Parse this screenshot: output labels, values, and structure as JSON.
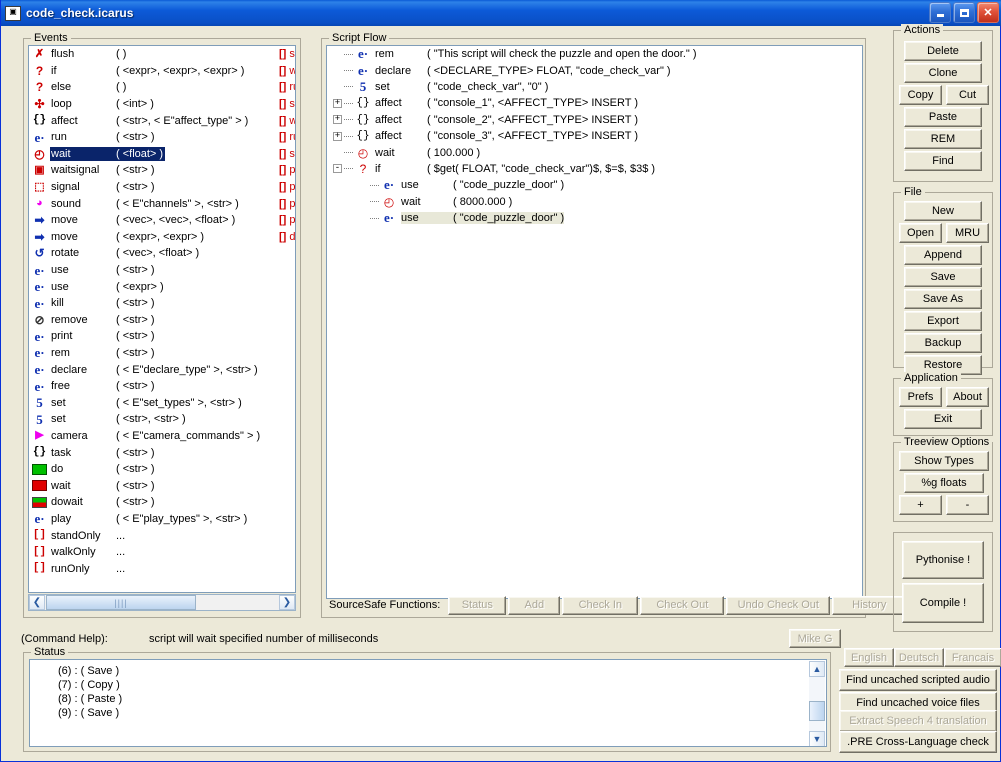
{
  "window": {
    "title": "code_check.icarus",
    "icon": "app-icon",
    "minimize": "_",
    "maximize": "□",
    "close": "✕"
  },
  "events_panel": {
    "label": "Events",
    "selected_index": 6,
    "items": [
      {
        "icon": "flush-icon",
        "glyph": "✗",
        "cls": "ic-flush",
        "name": "flush",
        "args": "(   )",
        "tail": "st"
      },
      {
        "icon": "question-icon",
        "glyph": "?",
        "cls": "ic-q",
        "name": "if",
        "args": "( <expr>, <expr>, <expr>  )",
        "tail": "w"
      },
      {
        "icon": "question-icon",
        "glyph": "?",
        "cls": "ic-q",
        "name": "else",
        "args": "(   )",
        "tail": "ru"
      },
      {
        "icon": "loop-icon",
        "glyph": "✣",
        "cls": "ic-loop",
        "name": "loop",
        "args": "( <int>  )",
        "tail": "st"
      },
      {
        "icon": "braces-icon",
        "glyph": "{}",
        "cls": "ic-brace",
        "name": "affect",
        "args": "( <str>, < E\"affect_type\" >  )",
        "tail": "w"
      },
      {
        "icon": "e-icon",
        "glyph": "e·",
        "cls": "ic-e",
        "name": "run",
        "args": "( <str>  )",
        "tail": "ru"
      },
      {
        "icon": "clock-icon",
        "glyph": "◴",
        "cls": "ic-clock",
        "name": "wait",
        "args": "( <float>  )",
        "tail": "st"
      },
      {
        "icon": "waitsignal-icon",
        "glyph": "▣",
        "cls": "ic-sq",
        "name": "waitsignal",
        "args": "( <str>  )",
        "tail": "pa"
      },
      {
        "icon": "signal-icon",
        "glyph": "⬚",
        "cls": "ic-sq",
        "name": "signal",
        "args": "( <str>  )",
        "tail": "pa"
      },
      {
        "icon": "sound-icon",
        "glyph": "◕",
        "cls": "ic-sound",
        "name": "sound",
        "args": "( < E\"channels\" >, <str>  )",
        "tail": "pa"
      },
      {
        "icon": "arrow-right-icon",
        "glyph": "➡",
        "cls": "ic-move",
        "name": "move",
        "args": "( <vec>, <vec>, <float>  )",
        "tail": "pa"
      },
      {
        "icon": "arrow-right-icon",
        "glyph": "➡",
        "cls": "ic-move",
        "name": "move",
        "args": "( <expr>, <expr>  )",
        "tail": "de"
      },
      {
        "icon": "rotate-icon",
        "glyph": "↺",
        "cls": "ic-rot",
        "name": "rotate",
        "args": "( <vec>, <float>  )",
        "tail": ""
      },
      {
        "icon": "e-icon",
        "glyph": "e·",
        "cls": "ic-e",
        "name": "use",
        "args": "( <str>  )",
        "tail": ""
      },
      {
        "icon": "e-icon",
        "glyph": "e·",
        "cls": "ic-e",
        "name": "use",
        "args": "( <expr>  )",
        "tail": ""
      },
      {
        "icon": "e-icon",
        "glyph": "e·",
        "cls": "ic-e",
        "name": "kill",
        "args": "( <str>  )",
        "tail": ""
      },
      {
        "icon": "remove-icon",
        "glyph": "⊘",
        "cls": "ic-rem",
        "name": "remove",
        "args": "( <str>  )",
        "tail": ""
      },
      {
        "icon": "e-icon",
        "glyph": "e·",
        "cls": "ic-e",
        "name": "print",
        "args": "( <str>  )",
        "tail": ""
      },
      {
        "icon": "e-icon",
        "glyph": "e·",
        "cls": "ic-e",
        "name": "rem",
        "args": "( <str>  )",
        "tail": ""
      },
      {
        "icon": "e-icon",
        "glyph": "e·",
        "cls": "ic-e",
        "name": "declare",
        "args": "( < E\"declare_type\" >, <str>  )",
        "tail": ""
      },
      {
        "icon": "e-icon",
        "glyph": "e·",
        "cls": "ic-e",
        "name": "free",
        "args": "( <str>  )",
        "tail": ""
      },
      {
        "icon": "set-icon",
        "glyph": "5",
        "cls": "ic-s5",
        "name": "set",
        "args": "( < E\"set_types\" >, <str>  )",
        "tail": ""
      },
      {
        "icon": "set-icon",
        "glyph": "5",
        "cls": "ic-s5",
        "name": "set",
        "args": "( <str>, <str>  )",
        "tail": ""
      },
      {
        "icon": "camera-icon",
        "glyph": "▶",
        "cls": "ic-cam",
        "name": "camera",
        "args": "( < E\"camera_commands\" >  )",
        "tail": ""
      },
      {
        "icon": "braces-icon",
        "glyph": "{}",
        "cls": "ic-brace",
        "name": "task",
        "args": "( <str>  )",
        "tail": ""
      },
      {
        "icon": "green-square-icon",
        "glyph": "",
        "cls": "ic-green",
        "name": "do",
        "args": "( <str>  )",
        "tail": ""
      },
      {
        "icon": "red-square-icon",
        "glyph": "",
        "cls": "ic-red",
        "name": "wait",
        "args": "( <str>  )",
        "tail": ""
      },
      {
        "icon": "split-square-icon",
        "glyph": "",
        "cls": "ic-split",
        "name": "dowait",
        "args": "( <str>  )",
        "tail": ""
      },
      {
        "icon": "e-icon",
        "glyph": "e·",
        "cls": "ic-e",
        "name": "play",
        "args": "( < E\"play_types\" >, <str>  )",
        "tail": ""
      },
      {
        "icon": "brackets-icon",
        "glyph": "[]",
        "cls": "ic-br",
        "name": "standOnly",
        "args": "...",
        "tail": ""
      },
      {
        "icon": "brackets-icon",
        "glyph": "[]",
        "cls": "ic-br",
        "name": "walkOnly",
        "args": "...",
        "tail": ""
      },
      {
        "icon": "brackets-icon",
        "glyph": "[]",
        "cls": "ic-br",
        "name": "runOnly",
        "args": "...",
        "tail": ""
      }
    ],
    "scroll_left_arrow": "❮",
    "scroll_right_arrow": "❯",
    "scroll_grip": "||||"
  },
  "script_flow_panel": {
    "label": "Script Flow",
    "rows": [
      {
        "depth": 0,
        "expander": "",
        "icon": "e-icon",
        "glyph": "e·",
        "cls": "ic-e",
        "name": "rem",
        "args": "( \"This script will check the puzzle and open the door.\"  )",
        "selected": false
      },
      {
        "depth": 0,
        "expander": "",
        "icon": "e-icon",
        "glyph": "e·",
        "cls": "ic-e",
        "name": "declare",
        "args": "( <DECLARE_TYPE> FLOAT, \"code_check_var\"  )",
        "selected": false
      },
      {
        "depth": 0,
        "expander": "",
        "icon": "set-icon",
        "glyph": "5",
        "cls": "ic-s5",
        "name": "set",
        "args": "( \"code_check_var\", \"0\"  )",
        "selected": false
      },
      {
        "depth": 0,
        "expander": "+",
        "icon": "braces-icon",
        "glyph": "{}",
        "cls": "ic-brace",
        "name": "affect",
        "args": "( \"console_1\", <AFFECT_TYPE> INSERT  )",
        "selected": false
      },
      {
        "depth": 0,
        "expander": "+",
        "icon": "braces-icon",
        "glyph": "{}",
        "cls": "ic-brace",
        "name": "affect",
        "args": "( \"console_2\", <AFFECT_TYPE> INSERT  )",
        "selected": false
      },
      {
        "depth": 0,
        "expander": "+",
        "icon": "braces-icon",
        "glyph": "{}",
        "cls": "ic-brace",
        "name": "affect",
        "args": "( \"console_3\", <AFFECT_TYPE> INSERT  )",
        "selected": false
      },
      {
        "depth": 0,
        "expander": "",
        "icon": "clock-icon",
        "glyph": "◴",
        "cls": "ic-clock",
        "name": "wait",
        "args": "( 100.000  )",
        "selected": false
      },
      {
        "depth": 0,
        "expander": "-",
        "icon": "question-icon",
        "glyph": "?",
        "cls": "ic-q",
        "name": "if",
        "args": "( $get( FLOAT, \"code_check_var\")$, $=$, $3$  )",
        "selected": false
      },
      {
        "depth": 1,
        "expander": "",
        "icon": "e-icon",
        "glyph": "e·",
        "cls": "ic-e",
        "name": "use",
        "args": "( \"code_puzzle_door\"  )",
        "selected": false
      },
      {
        "depth": 1,
        "expander": "",
        "icon": "clock-icon",
        "glyph": "◴",
        "cls": "ic-clock",
        "name": "wait",
        "args": "( 8000.000  )",
        "selected": false
      },
      {
        "depth": 1,
        "expander": "",
        "icon": "e-icon",
        "glyph": "e·",
        "cls": "ic-e",
        "name": "use",
        "args": "( \"code_puzzle_door\"  )",
        "selected": true
      }
    ]
  },
  "actions_panel": {
    "label": "Actions",
    "buttons": [
      {
        "name": "delete-button",
        "label": "Delete",
        "accel": "D",
        "enabled": true
      },
      {
        "name": "clone-button",
        "label": "Clone",
        "accel": "",
        "enabled": true
      },
      {
        "name": "copy-button",
        "label": "Copy",
        "accel": "C",
        "enabled": true
      },
      {
        "name": "cut-button",
        "label": "Cut",
        "accel": "",
        "enabled": true
      },
      {
        "name": "paste-button",
        "label": "Paste",
        "accel": "",
        "enabled": true
      },
      {
        "name": "rem-button",
        "label": "REM",
        "accel": "",
        "enabled": true
      },
      {
        "name": "find-button",
        "label": "Find",
        "accel": "F",
        "enabled": true
      }
    ]
  },
  "file_panel": {
    "label": "File",
    "buttons": [
      {
        "name": "new-button",
        "label": "New",
        "accel": "N"
      },
      {
        "name": "open-button",
        "label": "Open",
        "accel": "O"
      },
      {
        "name": "mru-button",
        "label": "MRU",
        "accel": "M"
      },
      {
        "name": "append-button",
        "label": "Append",
        "accel": ""
      },
      {
        "name": "save-button",
        "label": "Save",
        "accel": "S"
      },
      {
        "name": "save-as-button",
        "label": "Save As",
        "accel": "v"
      },
      {
        "name": "export-button",
        "label": "Export",
        "accel": ""
      },
      {
        "name": "backup-button",
        "label": "Backup",
        "accel": "B"
      },
      {
        "name": "restore-button",
        "label": "Restore",
        "accel": "R"
      }
    ]
  },
  "application_panel": {
    "label": "Application",
    "buttons": [
      {
        "name": "prefs-button",
        "label": "Prefs",
        "accel": "P"
      },
      {
        "name": "about-button",
        "label": "About",
        "accel": "b"
      },
      {
        "name": "exit-button",
        "label": "Exit",
        "accel": "x"
      }
    ]
  },
  "treeview_panel": {
    "label": "Treeview Options",
    "buttons": [
      {
        "name": "show-types-button",
        "label": "Show Types",
        "accel": ""
      },
      {
        "name": "g-floats-button",
        "label": "%g floats",
        "accel": "g"
      },
      {
        "name": "plus-button",
        "label": "+",
        "accel": ""
      },
      {
        "name": "minus-button",
        "label": "-",
        "accel": ""
      }
    ]
  },
  "compile_panel": {
    "buttons": [
      {
        "name": "pythonise-button",
        "label": "Pythonise !"
      },
      {
        "name": "compile-button",
        "label": "Compile !"
      }
    ]
  },
  "sourcesafe": {
    "label": "SourceSafe Functions:",
    "buttons": [
      {
        "name": "ss-status-button",
        "label": "Status",
        "enabled": false
      },
      {
        "name": "ss-add-button",
        "label": "Add",
        "enabled": false
      },
      {
        "name": "ss-check-in-button",
        "label": "Check In",
        "enabled": false
      },
      {
        "name": "ss-check-out-button",
        "label": "Check Out",
        "enabled": false
      },
      {
        "name": "ss-undo-check-out-button",
        "label": "Undo Check Out",
        "enabled": false
      },
      {
        "name": "ss-history-button",
        "label": "History",
        "enabled": false
      }
    ]
  },
  "command_help": {
    "label": "(Command Help):",
    "text": "script will wait specified number of milliseconds"
  },
  "status_panel": {
    "label": "Status",
    "rows": [
      "(6) : ( Save )",
      "(7) : ( Copy )",
      "(8) : ( Paste )",
      "(9) : ( Save )"
    ],
    "scroll_up_arrow": "▲",
    "scroll_down_arrow": "▼"
  },
  "bottom_right": {
    "user_button": {
      "name": "mike-g-button",
      "label": "Mike G",
      "enabled": false
    },
    "languages": [
      {
        "name": "english-button",
        "label": "English",
        "enabled": false
      },
      {
        "name": "deutsch-button",
        "label": "Deutsch",
        "enabled": false
      },
      {
        "name": "francais-button",
        "label": "Francais",
        "enabled": false
      }
    ],
    "tools": [
      {
        "name": "find-uncached-scripted-audio-button",
        "label": "Find uncached scripted audio",
        "enabled": true
      },
      {
        "name": "find-uncached-voice-files-button",
        "label": "Find uncached voice files",
        "enabled": true
      },
      {
        "name": "extract-speech-4-translation-button",
        "label": "Extract Speech 4 translation",
        "enabled": false
      },
      {
        "name": "pre-cross-language-check-button",
        "label": ".PRE Cross-Language check",
        "enabled": true
      }
    ]
  },
  "colors": {
    "window_bg": "#ece9d8",
    "titlebar": "#0a5ad6",
    "selection": "#0a246a",
    "accent_red": "#cc0000",
    "accent_blue": "#1030b0"
  }
}
